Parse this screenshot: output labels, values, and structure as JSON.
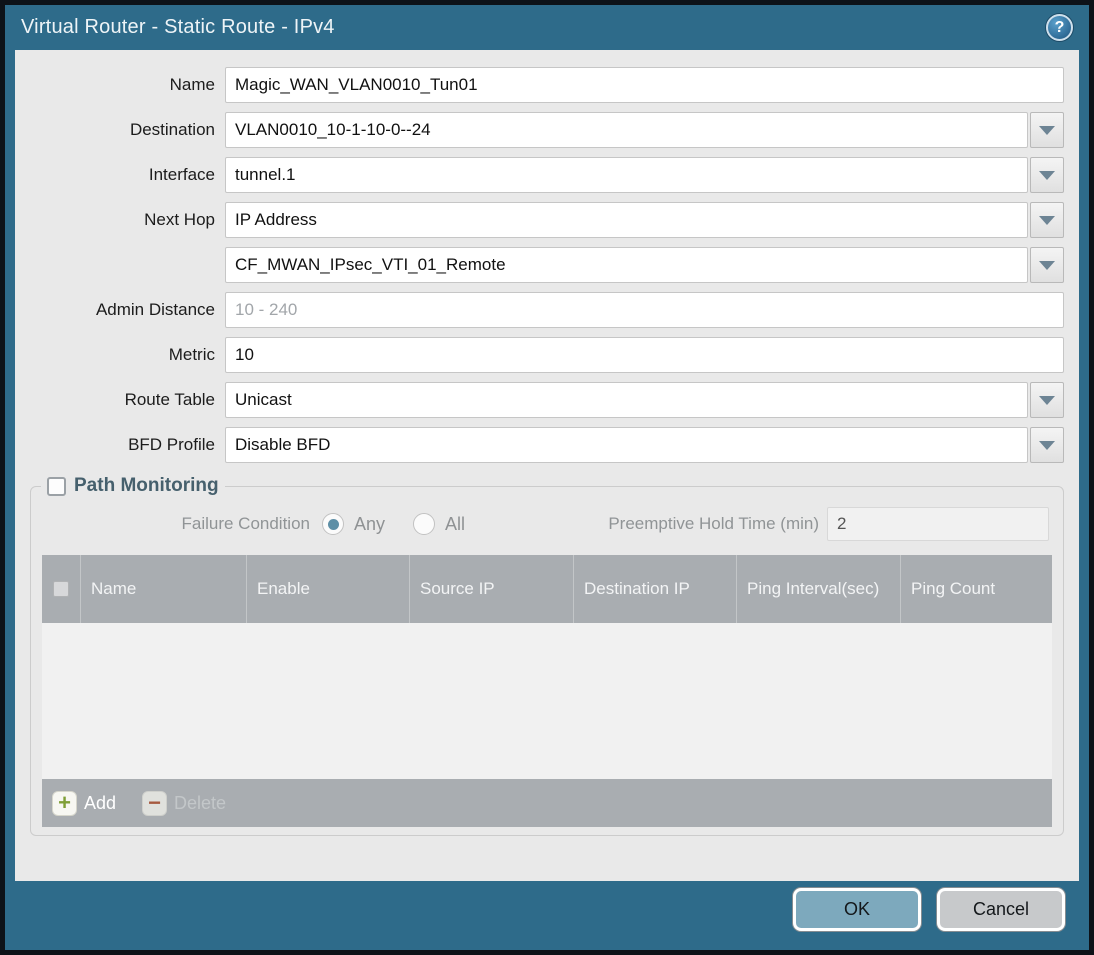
{
  "colors": {
    "frame_teal": "#2e6b8a",
    "outer_border": "#0d1218",
    "panel_bg": "#e9e9e9",
    "table_header_bg": "#a9adb1",
    "table_body_bg": "#f1f1f1",
    "ok_button_bg": "#7da9bd",
    "cancel_button_bg": "#c7c9cb",
    "add_icon_green": "#7f9f37",
    "delete_icon_red": "#a6593f",
    "dropdown_arrow": "#6d8494",
    "radio_selected": "#5e8fa6",
    "legend_text": "#46606d"
  },
  "title_bar": {
    "title": "Virtual Router - Static Route - IPv4",
    "help_icon_glyph": "?"
  },
  "form": {
    "fields": [
      {
        "label": "Name",
        "value": "Magic_WAN_VLAN0010_Tun01"
      },
      {
        "label": "Destination",
        "value": "VLAN0010_10-1-10-0--24"
      },
      {
        "label": "Interface",
        "value": "tunnel.1"
      },
      {
        "label": "Next Hop",
        "value": "IP Address"
      },
      {
        "label": "",
        "value": "CF_MWAN_IPsec_VTI_01_Remote"
      },
      {
        "label": "Admin Distance",
        "value": "",
        "placeholder": "10 - 240"
      },
      {
        "label": "Metric",
        "value": "10"
      },
      {
        "label": "Route Table",
        "value": "Unicast"
      },
      {
        "label": "BFD Profile",
        "value": "Disable BFD"
      }
    ]
  },
  "path_monitoring": {
    "legend": "Path Monitoring",
    "enabled": false,
    "failure_condition": {
      "label": "Failure Condition",
      "options": [
        {
          "label": "Any",
          "selected": true
        },
        {
          "label": "All",
          "selected": false
        }
      ]
    },
    "preemptive_hold": {
      "label": "Preemptive Hold Time (min)",
      "value": "2"
    },
    "table": {
      "headers": [
        "Name",
        "Enable",
        "Source IP",
        "Destination IP",
        "Ping Interval(sec)",
        "Ping Count"
      ],
      "rows": []
    },
    "toolbar": {
      "add_label": "Add",
      "delete_label": "Delete"
    }
  },
  "footer": {
    "ok_label": "OK",
    "cancel_label": "Cancel"
  }
}
